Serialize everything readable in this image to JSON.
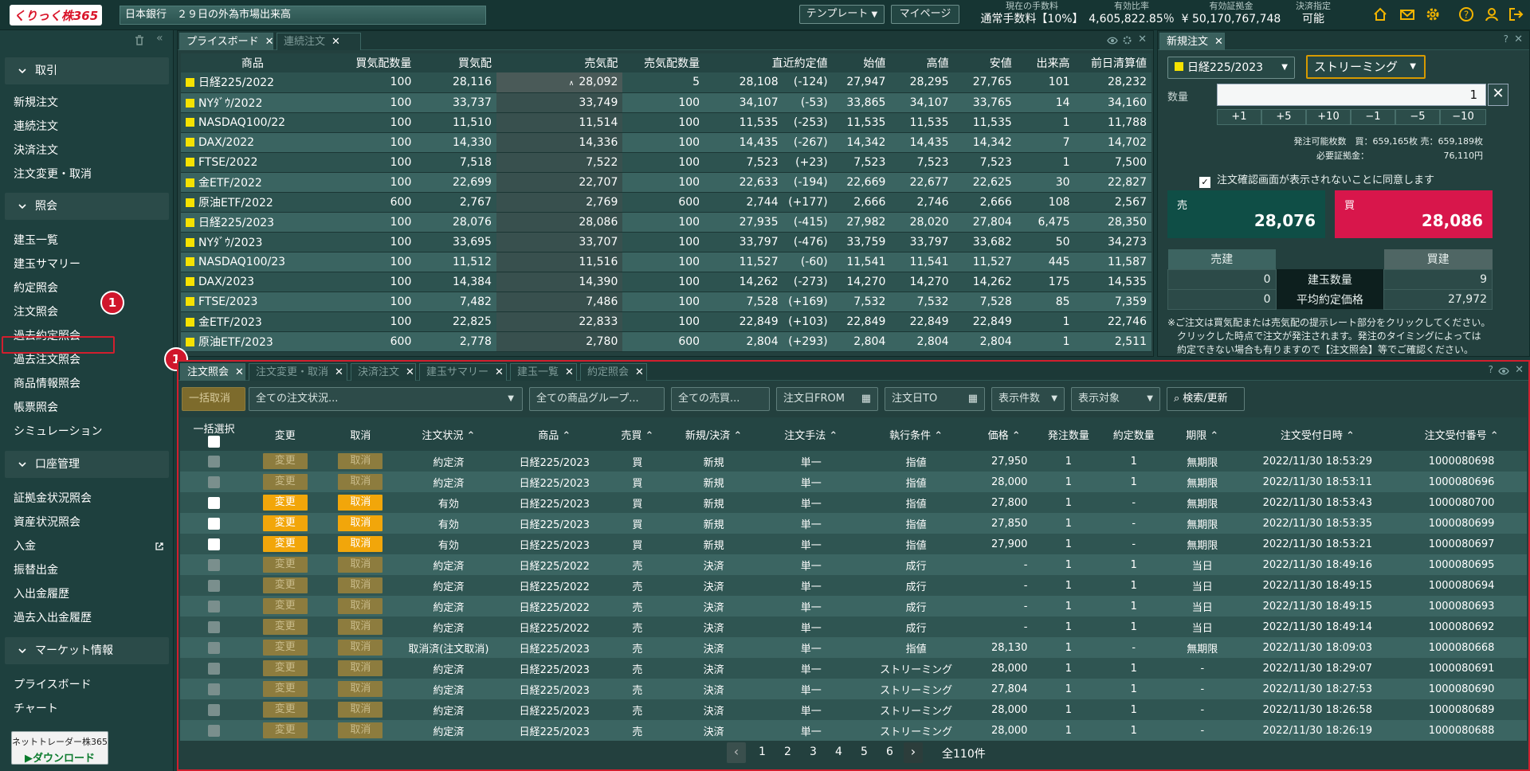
{
  "header": {
    "logo": "くりっく株365",
    "ticker": "日本銀行　２９日の外為市場出来高",
    "template_btn": "テンプレート",
    "mypage_btn": "マイページ",
    "stats": [
      {
        "label": "現在の手数料",
        "value": "通常手数料【10%】"
      },
      {
        "label": "有効比率",
        "value": "4,605,822.85％"
      },
      {
        "label": "有効証拠金",
        "value": "¥ 50,170,767,748"
      },
      {
        "label": "決済指定",
        "value": "可能"
      }
    ]
  },
  "sidebar": {
    "sections": [
      {
        "title": "取引",
        "items": [
          "新規注文",
          "連続注文",
          "決済注文",
          "注文変更・取消"
        ]
      },
      {
        "title": "照会",
        "items": [
          "建玉一覧",
          "建玉サマリー",
          "約定照会",
          "注文照会",
          "過去約定照会",
          "過去注文照会",
          "商品情報照会",
          "帳票照会",
          "シミュレーション"
        ]
      },
      {
        "title": "口座管理",
        "items": [
          "証拠金状況照会",
          "資産状況照会",
          "入金",
          "振替出金",
          "入出金履歴",
          "過去入出金履歴"
        ]
      },
      {
        "title": "マーケット情報",
        "items": [
          "プライスボード",
          "チャート"
        ]
      }
    ],
    "badge": "1",
    "download": {
      "line1": "ネットトレーダー株365",
      "line2": "ダウンロード"
    }
  },
  "priceboard": {
    "tabs": [
      "プライスボード",
      "連続注文"
    ],
    "headers": [
      "商品",
      "買気配数量",
      "買気配",
      "売気配",
      "売気配数量",
      "直近約定値",
      "始値",
      "高値",
      "安値",
      "出来高",
      "前日清算値"
    ],
    "rows": [
      [
        "日経225/2022",
        "100",
        "28,116",
        "28,092",
        "5",
        "28,108",
        "(-124)",
        "27,947",
        "28,295",
        "27,765",
        "101",
        "28,232"
      ],
      [
        "NYﾀﾞｳ/2022",
        "100",
        "33,737",
        "33,749",
        "100",
        "34,107",
        "(-53)",
        "33,865",
        "34,107",
        "33,765",
        "14",
        "34,160"
      ],
      [
        "NASDAQ100/22",
        "100",
        "11,510",
        "11,514",
        "100",
        "11,535",
        "(-253)",
        "11,535",
        "11,535",
        "11,535",
        "1",
        "11,788"
      ],
      [
        "DAX/2022",
        "100",
        "14,330",
        "14,336",
        "100",
        "14,435",
        "(-267)",
        "14,342",
        "14,435",
        "14,342",
        "7",
        "14,702"
      ],
      [
        "FTSE/2022",
        "100",
        "7,518",
        "7,522",
        "100",
        "7,523",
        "(+23)",
        "7,523",
        "7,523",
        "7,523",
        "1",
        "7,500"
      ],
      [
        "金ETF/2022",
        "100",
        "22,699",
        "22,707",
        "100",
        "22,633",
        "(-194)",
        "22,669",
        "22,677",
        "22,625",
        "30",
        "22,827"
      ],
      [
        "原油ETF/2022",
        "600",
        "2,767",
        "2,769",
        "600",
        "2,744",
        "(+177)",
        "2,666",
        "2,746",
        "2,666",
        "108",
        "2,567"
      ],
      [
        "日経225/2023",
        "100",
        "28,076",
        "28,086",
        "100",
        "27,935",
        "(-415)",
        "27,982",
        "28,020",
        "27,804",
        "6,475",
        "28,350"
      ],
      [
        "NYﾀﾞｳ/2023",
        "100",
        "33,695",
        "33,707",
        "100",
        "33,797",
        "(-476)",
        "33,759",
        "33,797",
        "33,682",
        "50",
        "34,273"
      ],
      [
        "NASDAQ100/23",
        "100",
        "11,512",
        "11,516",
        "100",
        "11,527",
        "(-60)",
        "11,541",
        "11,541",
        "11,527",
        "445",
        "11,587"
      ],
      [
        "DAX/2023",
        "100",
        "14,384",
        "14,390",
        "100",
        "14,262",
        "(-273)",
        "14,270",
        "14,270",
        "14,262",
        "175",
        "14,535"
      ],
      [
        "FTSE/2023",
        "100",
        "7,482",
        "7,486",
        "100",
        "7,528",
        "(+169)",
        "7,532",
        "7,532",
        "7,528",
        "85",
        "7,359"
      ],
      [
        "金ETF/2023",
        "100",
        "22,825",
        "22,833",
        "100",
        "22,849",
        "(+103)",
        "22,849",
        "22,849",
        "22,849",
        "1",
        "22,746"
      ],
      [
        "原油ETF/2023",
        "600",
        "2,778",
        "2,780",
        "600",
        "2,804",
        "(+293)",
        "2,804",
        "2,804",
        "2,804",
        "1",
        "2,511"
      ]
    ]
  },
  "neworder": {
    "tab": "新規注文",
    "product": "日経225/2023",
    "mode": "ストリーミング",
    "qty_label": "数量",
    "qty_value": "1",
    "steps": [
      "+1",
      "+5",
      "+10",
      "−1",
      "−5",
      "−10"
    ],
    "avail": "発注可能枚数　買：659,165枚 売：659,189枚",
    "margin": "必要証拠金：　　　　　　　　　76,110円",
    "confirm": "注文確認画面が表示されないことに同意します",
    "sell_label": "売",
    "sell_price": "28,076",
    "buy_label": "買",
    "buy_price": "28,086",
    "pos": {
      "sell_hdr": "売建",
      "buy_hdr": "買建",
      "qty_label": "建玉数量",
      "avg_label": "平均約定価格",
      "sell_qty": "0",
      "sell_avg": "0",
      "buy_qty": "9",
      "buy_avg": "27,972"
    },
    "note": [
      "※ご注文は買気配または売気配の提示レート部分をクリックしてください。",
      "　クリックした時点で注文が発注されます。発注のタイミングによっては",
      "　約定できない場合も有りますので【注文照会】等でご確認ください。"
    ]
  },
  "orders": {
    "tabs": [
      "注文照会",
      "注文変更・取消",
      "決済注文",
      "建玉サマリー",
      "建玉一覧",
      "約定照会"
    ],
    "filters": {
      "bulk_cancel": "一括取消",
      "status": "全ての注文状況...",
      "group": "全ての商品グループ...",
      "side": "全ての売買...",
      "from": "注文日FROM",
      "to": "注文日TO",
      "count": "表示件数",
      "target": "表示対象",
      "search": "検索/更新"
    },
    "headers": [
      "一括選択",
      "変更",
      "取消",
      "注文状況",
      "商品",
      "売買",
      "新規/決済",
      "注文手法",
      "執行条件",
      "価格",
      "発注数量",
      "約定数量",
      "期限",
      "注文受付日時",
      "注文受付番号"
    ],
    "change_label": "変更",
    "cancel_label": "取消",
    "rows": [
      [
        "0",
        "約定済",
        "日経225/2023",
        "買",
        "新規",
        "単一",
        "指値",
        "27,950",
        "1",
        "1",
        "無期限",
        "2022/11/30 18:53:29",
        "1000080698"
      ],
      [
        "0",
        "約定済",
        "日経225/2023",
        "買",
        "新規",
        "単一",
        "指値",
        "28,000",
        "1",
        "1",
        "無期限",
        "2022/11/30 18:53:11",
        "1000080696"
      ],
      [
        "1",
        "有効",
        "日経225/2023",
        "買",
        "新規",
        "単一",
        "指値",
        "27,800",
        "1",
        "-",
        "無期限",
        "2022/11/30 18:53:43",
        "1000080700"
      ],
      [
        "1",
        "有効",
        "日経225/2023",
        "買",
        "新規",
        "単一",
        "指値",
        "27,850",
        "1",
        "-",
        "無期限",
        "2022/11/30 18:53:35",
        "1000080699"
      ],
      [
        "1",
        "有効",
        "日経225/2023",
        "買",
        "新規",
        "単一",
        "指値",
        "27,900",
        "1",
        "-",
        "無期限",
        "2022/11/30 18:53:21",
        "1000080697"
      ],
      [
        "0",
        "約定済",
        "日経225/2022",
        "売",
        "決済",
        "単一",
        "成行",
        "-",
        "1",
        "1",
        "当日",
        "2022/11/30 18:49:16",
        "1000080695"
      ],
      [
        "0",
        "約定済",
        "日経225/2022",
        "売",
        "決済",
        "単一",
        "成行",
        "-",
        "1",
        "1",
        "当日",
        "2022/11/30 18:49:15",
        "1000080694"
      ],
      [
        "0",
        "約定済",
        "日経225/2022",
        "売",
        "決済",
        "単一",
        "成行",
        "-",
        "1",
        "1",
        "当日",
        "2022/11/30 18:49:15",
        "1000080693"
      ],
      [
        "0",
        "約定済",
        "日経225/2022",
        "売",
        "決済",
        "単一",
        "成行",
        "-",
        "1",
        "1",
        "当日",
        "2022/11/30 18:49:14",
        "1000080692"
      ],
      [
        "0",
        "取消済(注文取消)",
        "日経225/2023",
        "売",
        "決済",
        "単一",
        "指値",
        "28,130",
        "1",
        "-",
        "無期限",
        "2022/11/30 18:09:03",
        "1000080668"
      ],
      [
        "0",
        "約定済",
        "日経225/2023",
        "売",
        "決済",
        "単一",
        "ストリーミング",
        "28,000",
        "1",
        "1",
        "-",
        "2022/11/30 18:29:07",
        "1000080691"
      ],
      [
        "0",
        "約定済",
        "日経225/2023",
        "売",
        "決済",
        "単一",
        "ストリーミング",
        "27,804",
        "1",
        "1",
        "-",
        "2022/11/30 18:27:53",
        "1000080690"
      ],
      [
        "0",
        "約定済",
        "日経225/2023",
        "売",
        "決済",
        "単一",
        "ストリーミング",
        "28,000",
        "1",
        "1",
        "-",
        "2022/11/30 18:26:58",
        "1000080689"
      ],
      [
        "0",
        "約定済",
        "日経225/2023",
        "売",
        "決済",
        "単一",
        "ストリーミング",
        "28,000",
        "1",
        "1",
        "-",
        "2022/11/30 18:26:19",
        "1000080688"
      ]
    ],
    "pages": [
      "1",
      "2",
      "3",
      "4",
      "5",
      "6"
    ],
    "total": "全110件"
  }
}
